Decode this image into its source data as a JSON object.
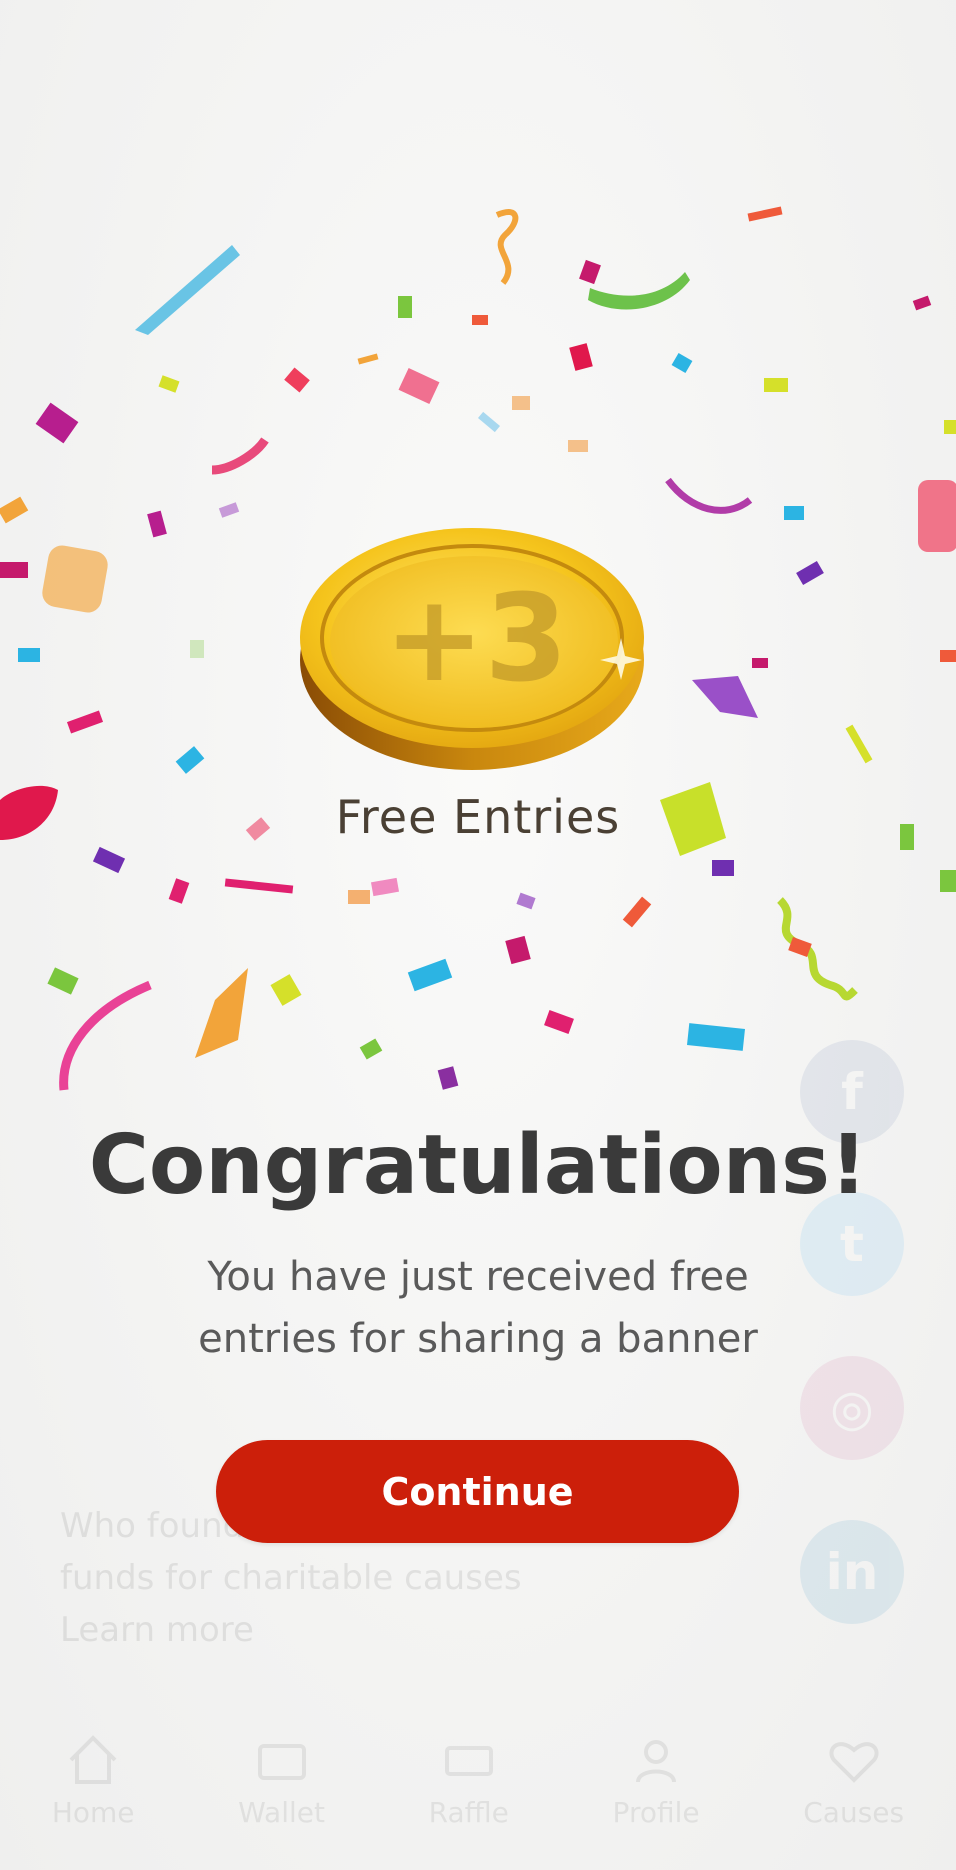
{
  "reward": {
    "coin_label": "+3",
    "subtitle_label": "Free Entries"
  },
  "dialog": {
    "title": "Congratulations!",
    "message": "You have just received free entries for sharing a banner",
    "continue_label": "Continue"
  },
  "colors": {
    "accent": "#cc1f0a",
    "coin_gold": "#f2c21b",
    "coin_dark": "#b07a0c",
    "title": "#3a3a3a",
    "text": "#5a5a5a"
  },
  "background": {
    "social_icons": [
      "facebook-icon",
      "twitter-icon",
      "instagram-icon",
      "linkedin-icon"
    ],
    "text_lines": [
      "Who found",
      "funds for charitable causes",
      "Learn more"
    ],
    "nav_items": [
      {
        "label": "Home",
        "icon": "home-icon"
      },
      {
        "label": "Wallet",
        "icon": "wallet-icon"
      },
      {
        "label": "Raffle",
        "icon": "ticket-icon"
      },
      {
        "label": "Profile",
        "icon": "user-icon"
      },
      {
        "label": "Causes",
        "icon": "heart-icon"
      }
    ]
  }
}
